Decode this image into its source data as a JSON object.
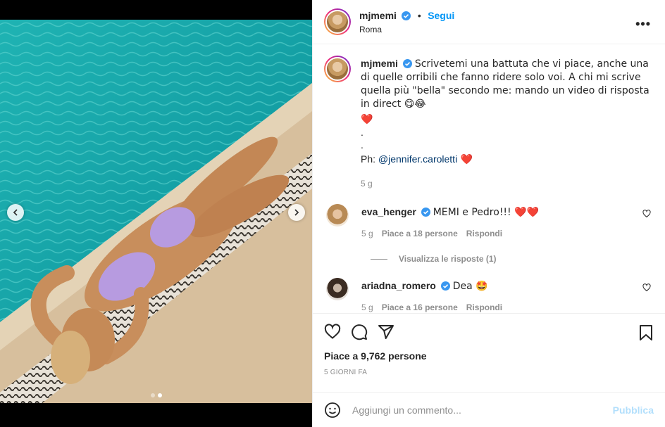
{
  "post": {
    "username": "mjmemi",
    "follow_label": "Segui",
    "bullet": "•",
    "location": "Roma",
    "more_label": "•••"
  },
  "caption": {
    "username": "mjmemi",
    "line1": "Scrivetemi una battuta che vi piace, anche una di quelle orribili che fanno ridere solo voi. A chi mi scrive quella più \"bella\" secondo me: mando un video di risposta in direct 😋😂",
    "heart_line": "❤️",
    "dot1": ".",
    "dot2": ".",
    "ph_prefix": "Ph: ",
    "ph_mention": "@jennifer.caroletti",
    "ph_suffix": " ❤️",
    "time": "5 g"
  },
  "comments": [
    {
      "username": "eva_henger",
      "text": "MEMI e Pedro!!! ❤️❤️",
      "time": "5 g",
      "likes": "Piace a 18 persone",
      "reply": "Rispondi",
      "view_replies": "Visualizza le risposte (1)"
    },
    {
      "username": "ariadna_romero",
      "text": "Dea 🤩",
      "time": "5 g",
      "likes": "Piace a 16 persone",
      "reply": "Rispondi"
    }
  ],
  "footer": {
    "likes": "Piace a 9,762 persone",
    "time_ago": "5 GIORNI FA",
    "comment_placeholder": "Aggiungi un commento...",
    "publish_label": "Pubblica"
  },
  "colors": {
    "accent": "#0095f6",
    "pool": "#0fa4a8",
    "stone": "#d9c3a2"
  },
  "carousel": {
    "slides": 2,
    "active": 2
  }
}
